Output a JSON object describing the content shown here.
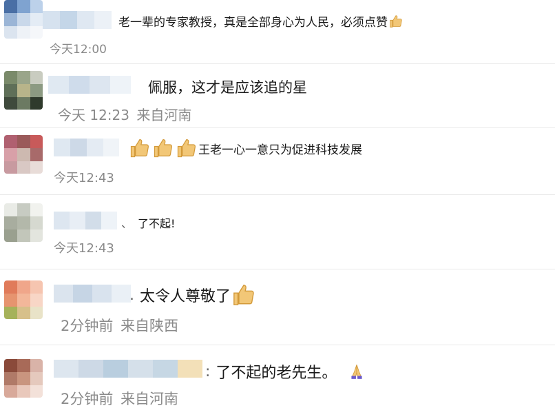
{
  "comments": [
    {
      "text": "老一辈的专家教授，真是全部身心为人民，必须点赞",
      "emoji_after": [
        "thumbs-up"
      ],
      "time": "今天12:00",
      "location": ""
    },
    {
      "text": "佩服，这才是应该追的星",
      "emoji_after": [],
      "time": "今天 12:23",
      "location": "来自河南"
    },
    {
      "text": "王老一心一意只为促进科技发展",
      "emoji_before": [
        "thumbs-up",
        "thumbs-up",
        "thumbs-up"
      ],
      "time": "今天12:43",
      "location": ""
    },
    {
      "separator": "、",
      "text": "了不起!",
      "time": "今天12:43",
      "location": ""
    },
    {
      "separator": ".",
      "text": "太令人尊敬了",
      "emoji_after": [
        "thumbs-up"
      ],
      "time": "2分钟前",
      "location": "来自陕西"
    },
    {
      "separator": ":",
      "text": "了不起的老先生。",
      "emoji_after": [
        "praying-hands"
      ],
      "time": "2分钟前",
      "location": "来自河南"
    }
  ],
  "colors": {
    "text": "#1a1a1a",
    "meta": "#8a8a8a",
    "divider": "#e9e9e9",
    "thumb": "#f2c777",
    "prayer": "#6a5acd"
  }
}
